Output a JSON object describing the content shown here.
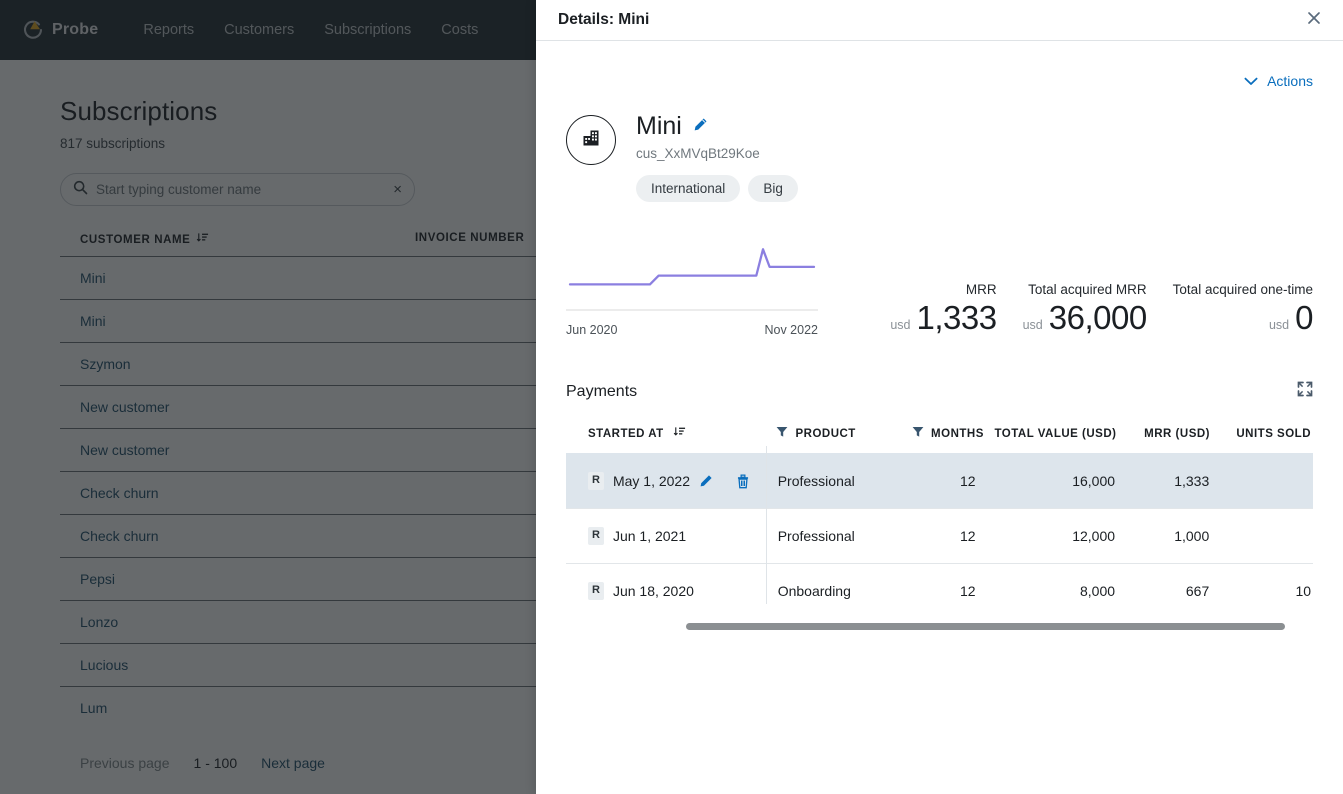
{
  "app": {
    "brand": "Probe",
    "nav": [
      {
        "label": "Reports"
      },
      {
        "label": "Customers"
      },
      {
        "label": "Subscriptions"
      },
      {
        "label": "Costs"
      }
    ],
    "page_title": "Subscriptions",
    "page_subtitle": "817 subscriptions",
    "search": {
      "placeholder": "Start typing customer name",
      "value": "",
      "clear_label": "×"
    },
    "table": {
      "columns": [
        "CUSTOMER NAME",
        "INVOICE NUMBER"
      ],
      "rows": [
        {
          "customer": "Mini",
          "selected": true
        },
        {
          "customer": "Mini",
          "selected": true
        },
        {
          "customer": "Szymon",
          "selected": false
        },
        {
          "customer": "New customer",
          "selected": false
        },
        {
          "customer": "New customer",
          "selected": false
        },
        {
          "customer": "Check churn",
          "selected": false
        },
        {
          "customer": "Check churn",
          "selected": false
        },
        {
          "customer": "Pepsi",
          "selected": false
        },
        {
          "customer": "Lonzo",
          "selected": false
        },
        {
          "customer": "Lucious",
          "selected": false
        },
        {
          "customer": "Lum",
          "selected": false
        }
      ]
    },
    "pagination": {
      "previous": "Previous page",
      "range": "1 - 100",
      "next": "Next page"
    }
  },
  "drawer": {
    "title": "Details: Mini",
    "close_label": "×",
    "actions_label": "Actions",
    "customer": {
      "name": "Mini",
      "id": "cus_XxMVqBt29Koe",
      "tags": [
        "International",
        "Big"
      ]
    },
    "kpis": [
      {
        "label": "MRR",
        "currency": "usd",
        "value": "1,333"
      },
      {
        "label": "Total acquired MRR",
        "currency": "usd",
        "value": "36,000"
      },
      {
        "label": "Total acquired one-time",
        "currency": "usd",
        "value": "0"
      }
    ],
    "payments": {
      "section_title": "Payments",
      "columns": [
        "STARTED AT",
        "PRODUCT",
        "MONTHS",
        "TOTAL VALUE (USD)",
        "MRR (USD)",
        "UNITS SOLD"
      ],
      "rows": [
        {
          "type": "R",
          "started_at": "May 1, 2022",
          "product": "Professional",
          "months": "12",
          "total_value": "16,000",
          "mrr": "1,333",
          "units": "",
          "highlighted": true
        },
        {
          "type": "R",
          "started_at": "Jun 1, 2021",
          "product": "Professional",
          "months": "12",
          "total_value": "12,000",
          "mrr": "1,000",
          "units": "",
          "highlighted": false
        },
        {
          "type": "R",
          "started_at": "Jun 18, 2020",
          "product": "Onboarding",
          "months": "12",
          "total_value": "8,000",
          "mrr": "667",
          "units": "10",
          "highlighted": false
        }
      ]
    }
  },
  "chart_data": {
    "type": "line",
    "title": "",
    "xlabel": "",
    "ylabel": "",
    "x_tick_labels": [
      "Jun 2020",
      "Nov 2022"
    ],
    "x": [
      0,
      18,
      20,
      42,
      43.5,
      45,
      48,
      55
    ],
    "values": [
      667,
      667,
      1000,
      1000,
      2000,
      1333,
      1333,
      1333
    ],
    "ylim": [
      0,
      2200
    ],
    "grid": false,
    "legend": "none",
    "color": "#8b7fe0"
  },
  "colors": {
    "brand_dark": "#222d34",
    "brand_accent": "#e3a61b",
    "link": "#0a6ebd",
    "spark": "#8b7fe0",
    "row_highlight": "#dde5ec"
  }
}
